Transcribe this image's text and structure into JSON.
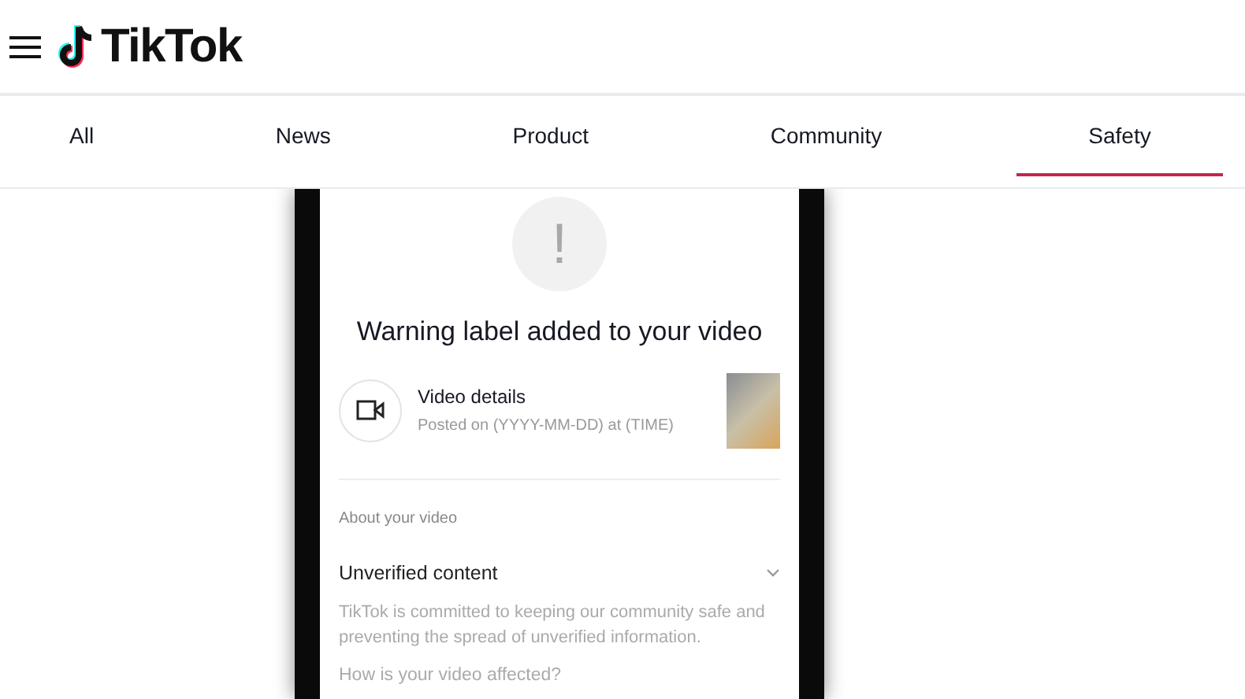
{
  "header": {
    "logo_text": "TikTok"
  },
  "tabs": [
    {
      "label": "All",
      "selected": false
    },
    {
      "label": "News",
      "selected": false
    },
    {
      "label": "Product",
      "selected": false
    },
    {
      "label": "Community",
      "selected": false
    },
    {
      "label": "Safety",
      "selected": true
    }
  ],
  "phone": {
    "icon_text": "!",
    "title": "Warning label added to your video",
    "video": {
      "title": "Video details",
      "subtitle": "Posted on (YYYY-MM-DD) at (TIME)"
    },
    "section_label": "About your video",
    "accordion": {
      "title": "Unverified content",
      "expanded": true,
      "body": "TikTok is committed to keeping our community safe and preventing the spread of unverified information.",
      "question": "How is your video affected?"
    }
  }
}
